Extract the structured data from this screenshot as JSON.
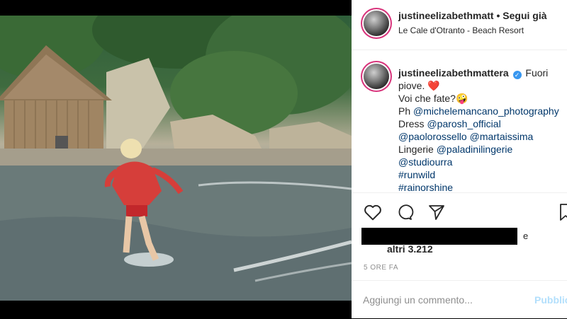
{
  "post": {
    "header": {
      "username": "justineelizabethmatt",
      "separator": "•",
      "follow_label": "Segui già",
      "location": "Le Cale d'Otranto - Beach Resort"
    },
    "caption": {
      "username": "justineelizabethmattera",
      "verified_icon": "verified-badge-icon",
      "line1": "Fuori",
      "line2": "piove.",
      "heart_emoji": "❤️",
      "line3": "Voi che fate?",
      "crazy_emoji": "🤪",
      "ph_label": "Ph",
      "ph_link": "@michelemancano_photography",
      "dress_label": "Dress",
      "dress_link": "@parosh_official",
      "link_a": "@paolorossello",
      "link_b": "@martaissima",
      "lingerie_label": "Lingerie",
      "lingerie_link": "@paladinilingerie",
      "studio_link": "@studiourra",
      "tag1": "#runwild",
      "tag2": "#rainorshine"
    },
    "likes": {
      "and_label": "e",
      "others": "altri 3.212"
    },
    "timestamp": "5 ORE FA",
    "comment": {
      "placeholder": "Aggiungi un commento...",
      "publish_label": "Pubblica"
    },
    "icons": [
      "heart-icon",
      "comment-icon",
      "share-icon",
      "bookmark-icon"
    ],
    "colors": {
      "link": "#00376b",
      "verified": "#3897f0",
      "story_ring": "#d8337b",
      "publish_disabled": "#b2dffc"
    }
  }
}
